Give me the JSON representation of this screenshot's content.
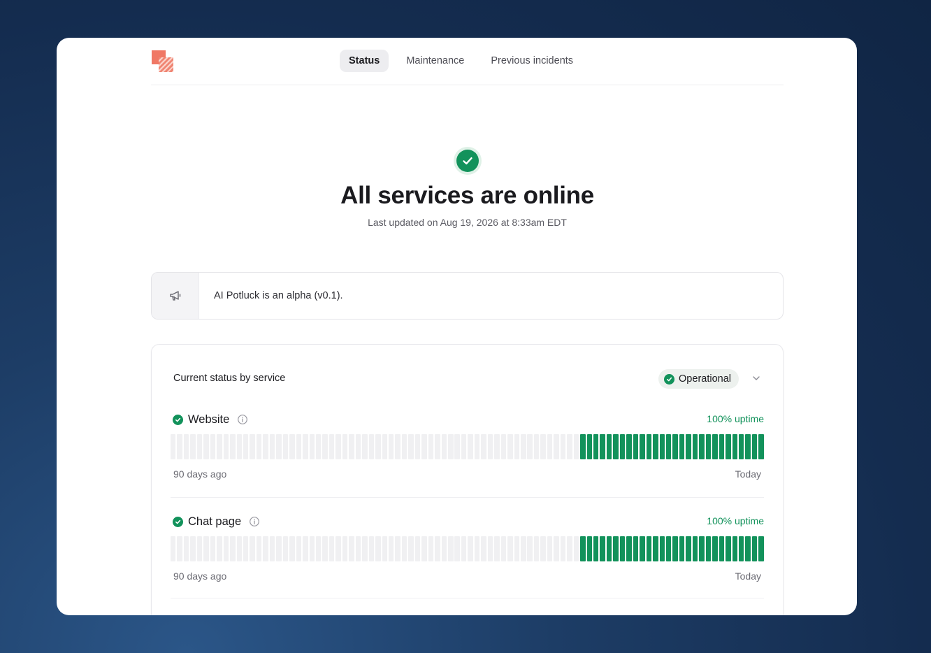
{
  "nav": {
    "tabs": [
      {
        "label": "Status",
        "active": true
      },
      {
        "label": "Maintenance",
        "active": false
      },
      {
        "label": "Previous incidents",
        "active": false
      }
    ]
  },
  "hero": {
    "title": "All services are online",
    "last_updated": "Last updated on Aug 19, 2026 at 8:33am EDT",
    "icon": "check-circle-icon"
  },
  "notice": {
    "icon": "megaphone-icon",
    "text": "AI Potluck is an alpha (v0.1)."
  },
  "status_section": {
    "title": "Current status by service",
    "filter": {
      "label": "Operational",
      "icon": "check-circle-icon"
    },
    "services": [
      {
        "name": "Website",
        "uptime_label": "100% uptime",
        "range_start": "90 days ago",
        "range_end": "Today",
        "days_total": 90,
        "days_with_data": 28
      },
      {
        "name": "Chat page",
        "uptime_label": "100% uptime",
        "range_start": "90 days ago",
        "range_end": "Today",
        "days_total": 90,
        "days_with_data": 28
      }
    ]
  },
  "colors": {
    "operational": "#12925b",
    "no_data": "#f0f0f2",
    "logo": "#f07865"
  }
}
